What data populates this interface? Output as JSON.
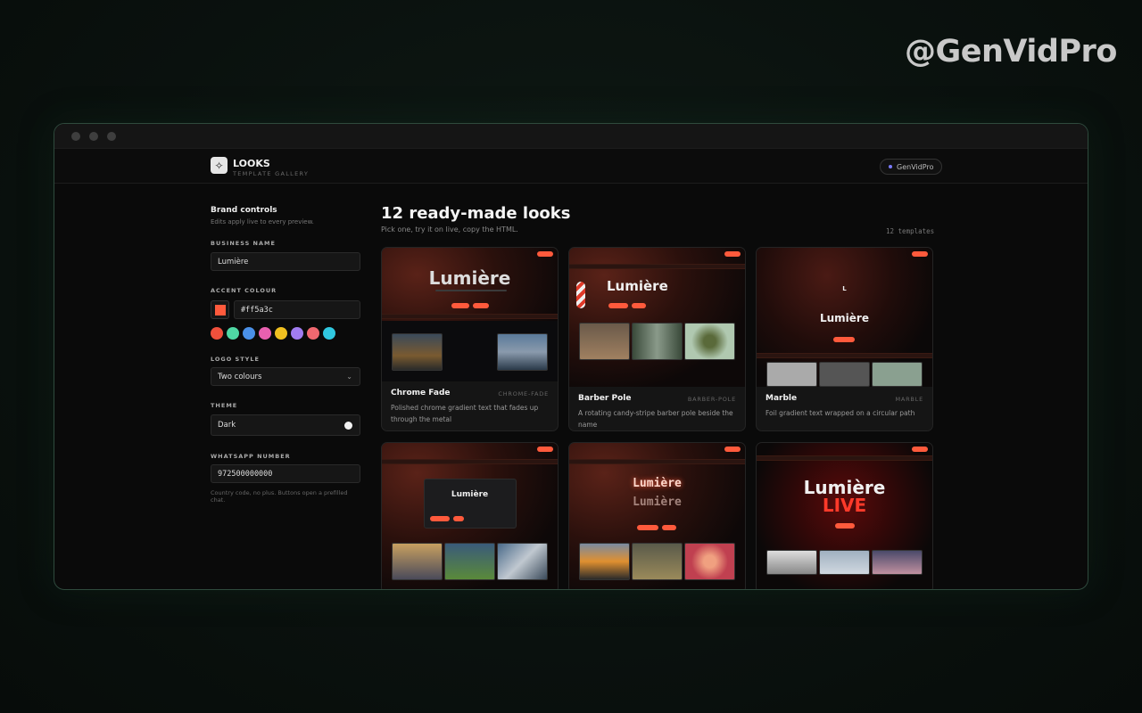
{
  "watermark": "@GenVidPro",
  "header": {
    "logo_icon": "sparkle-icon",
    "brand": "LOOKS",
    "brand_sub": "TEMPLATE GALLERY",
    "user": "GenVidPro"
  },
  "sidebar": {
    "title": "Brand controls",
    "subtitle": "Edits apply live to every preview.",
    "business_name_label": "BUSINESS NAME",
    "business_name_value": "Lumière",
    "accent_label": "ACCENT COLOUR",
    "accent_hex": "#ff5a3c",
    "accent_value": "#ff5a3c",
    "swatch_colors": [
      "#f0503c",
      "#4fd8a4",
      "#4a90e8",
      "#e860b0",
      "#f0c020",
      "#a07cf0",
      "#f06870",
      "#30c8e0"
    ],
    "logo_style_label": "LOGO STYLE",
    "logo_style_value": "Two colours",
    "theme_label": "THEME",
    "theme_value": "Dark",
    "whatsapp_label": "WHATSAPP NUMBER",
    "whatsapp_value": "972500000000",
    "whatsapp_hint": "Country code, no plus. Buttons open a prefilled chat."
  },
  "main": {
    "title": "12 ready-made looks",
    "subtitle": "Pick one, try it on live, copy the HTML.",
    "count": "12 templates"
  },
  "cards": [
    {
      "name": "Chrome Fade",
      "slug": "CHROME-FADE",
      "desc": "Polished chrome gradient text that fades up through the metal",
      "preview_title": "Lumière"
    },
    {
      "name": "Barber Pole",
      "slug": "BARBER-POLE",
      "desc": "A rotating candy-stripe barber pole beside the name",
      "preview_title": "Lumière"
    },
    {
      "name": "Marble",
      "slug": "MARBLE",
      "desc": "Foil gradient text wrapped on a circular path",
      "preview_title": "Lumière"
    },
    {
      "preview_title": "Lumière"
    },
    {
      "preview_title": "Lumière",
      "preview_title2": "Lumière"
    },
    {
      "preview_title": "Lumière",
      "preview_title2": "LIVE"
    }
  ]
}
